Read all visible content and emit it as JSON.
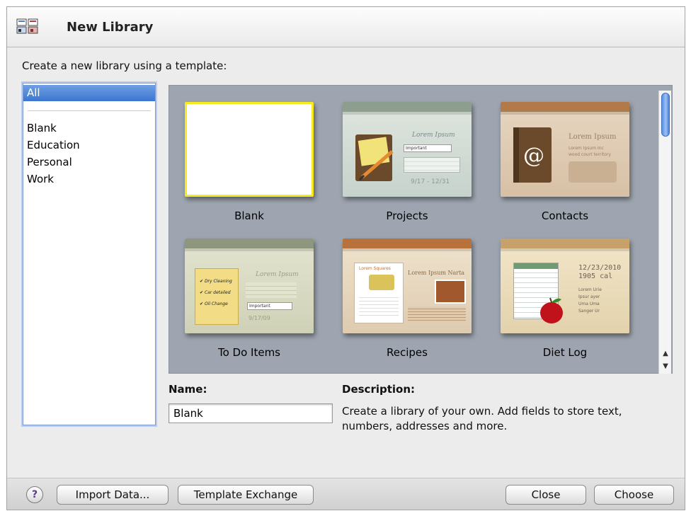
{
  "window": {
    "title": "New Library"
  },
  "prompt": "Create a new library using a template:",
  "categories": {
    "selected": "All",
    "items": [
      "Blank",
      "Education",
      "Personal",
      "Work"
    ]
  },
  "templates": [
    {
      "label": "Blank"
    },
    {
      "label": "Projects",
      "heading": "Lorem Ipsum",
      "tag": "Important",
      "note": "Project status",
      "dates": "9/17 - 12/31"
    },
    {
      "label": "Contacts",
      "heading": "Lorem Ipsum",
      "lines": [
        "Lorem Ipsum Inc",
        "wood court territory"
      ],
      "symbol": "@"
    },
    {
      "label": "To Do Items",
      "heading": "Lorem Ipsum",
      "checks": [
        "Dry Cleaning",
        "Car detailed",
        "Oil Change"
      ],
      "tag": "Important",
      "date": "9/17/09"
    },
    {
      "label": "Recipes",
      "heading": "Lorem Ipsum Narta",
      "card": "Lorem Squares"
    },
    {
      "label": "Diet Log",
      "date": "12/23/2010",
      "cal": "1905 cal",
      "lines": [
        "Lorem Urie",
        "Ipsur ayer",
        "Uma Uma",
        "Sanger Ur"
      ]
    }
  ],
  "name_field": {
    "label": "Name:",
    "value": "Blank"
  },
  "description": {
    "label": "Description:",
    "text": "Create a library of your own. Add fields to store text, numbers, addresses and more."
  },
  "buttons": {
    "help": "?",
    "import": "Import Data...",
    "template_exchange": "Template Exchange",
    "close": "Close",
    "choose": "Choose"
  },
  "colors": {
    "selection": "#3c76cf",
    "gallery_bg": "#9ea5b0",
    "blank_border": "#f5ea1d"
  }
}
